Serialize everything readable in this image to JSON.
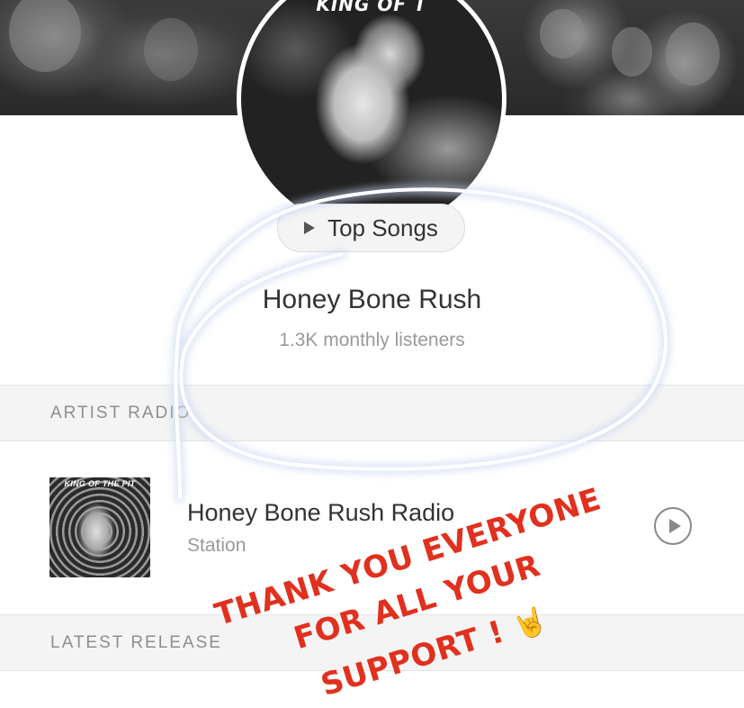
{
  "banner": {
    "avatar_text": "KING OF T"
  },
  "top_songs": {
    "label": "Top Songs",
    "icon": "play-icon"
  },
  "artist": {
    "name": "Honey Bone Rush",
    "listeners": "1.3K monthly listeners"
  },
  "artist_radio": {
    "header": "ARTIST RADIO",
    "station": {
      "thumb_text": "KING OF THE PIT",
      "title": "Honey Bone Rush Radio",
      "subtitle": "Station",
      "icon": "play-circle-icon"
    }
  },
  "latest_release": {
    "header": "LATEST RELEASE"
  },
  "annotation": {
    "line1": "THANK YOU EVERYONE",
    "line2": "FOR ALL YOUR",
    "line3": "SUPPORT !",
    "emoji": "🤘",
    "color": "#e1301e"
  }
}
